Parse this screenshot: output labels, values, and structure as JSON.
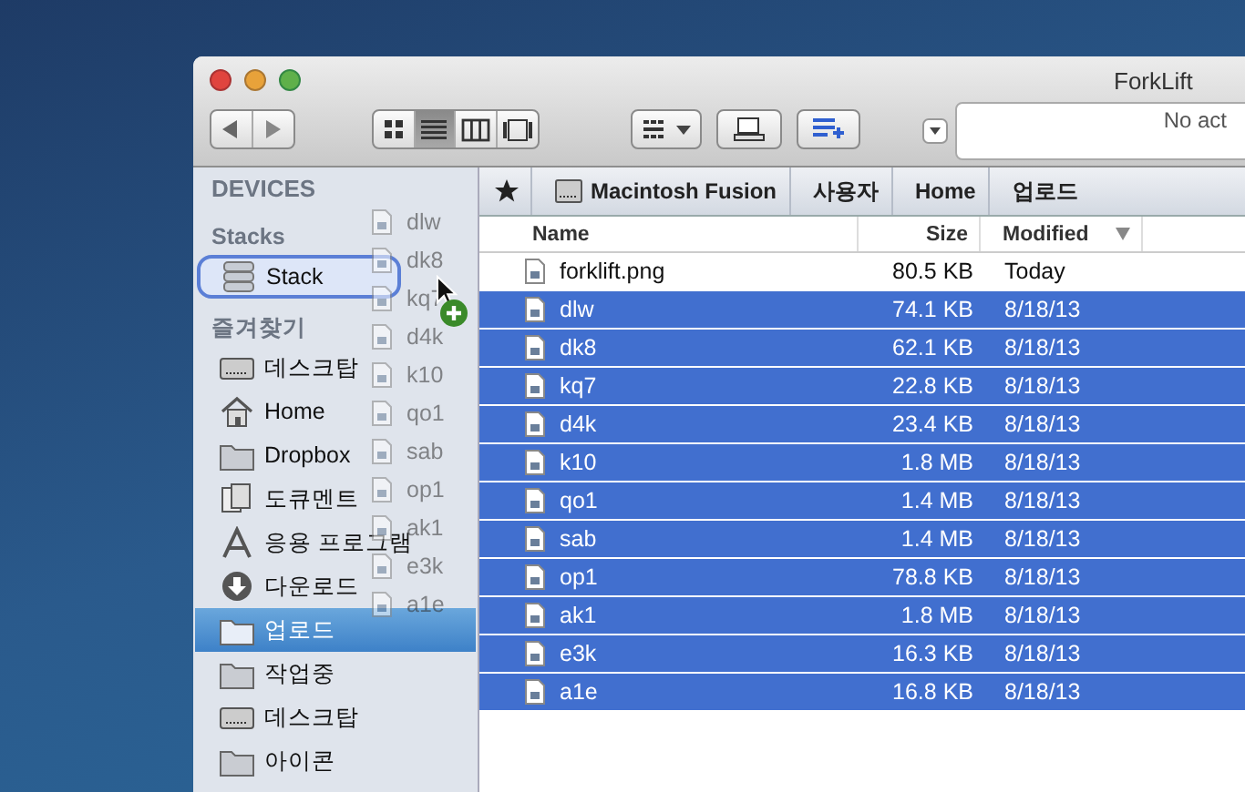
{
  "window": {
    "title": "ForkLift"
  },
  "toolbar": {
    "view_modes": [
      {
        "kind": "icons",
        "selected": false
      },
      {
        "kind": "list",
        "selected": true
      },
      {
        "kind": "columns",
        "selected": false
      },
      {
        "kind": "coverflow",
        "selected": false
      }
    ],
    "search": {
      "placeholder": "No act"
    }
  },
  "sidebar": {
    "sections": [
      {
        "title": "DEVICES"
      },
      {
        "title": "Stacks",
        "items": [
          {
            "label": "Stack",
            "kind": "stack",
            "selected": false,
            "drop_target": true
          }
        ]
      },
      {
        "title": "즐겨찾기",
        "items": [
          {
            "label": "데스크탑",
            "kind": "disk",
            "selected": false,
            "drop_target": false
          },
          {
            "label": "Home",
            "kind": "home",
            "selected": false,
            "drop_target": false
          },
          {
            "label": "Dropbox",
            "kind": "folder",
            "selected": false,
            "drop_target": false
          },
          {
            "label": "도큐멘트",
            "kind": "documents",
            "selected": false,
            "drop_target": false
          },
          {
            "label": "응용 프로그램",
            "kind": "apps",
            "selected": false,
            "drop_target": false
          },
          {
            "label": "다운로드",
            "kind": "download",
            "selected": false,
            "drop_target": false
          },
          {
            "label": "업로드",
            "kind": "folder",
            "selected": true,
            "drop_target": false
          },
          {
            "label": "작업중",
            "kind": "folder",
            "selected": false,
            "drop_target": false
          },
          {
            "label": "데스크탑",
            "kind": "disk",
            "selected": false,
            "drop_target": false
          },
          {
            "label": "아이콘",
            "kind": "folder",
            "selected": false,
            "drop_target": false
          }
        ]
      }
    ]
  },
  "path_bar": [
    {
      "label": "Macintosh Fusion",
      "kind": "disk"
    },
    {
      "label": "사용자",
      "kind": "plain"
    },
    {
      "label": "Home",
      "kind": "plain"
    },
    {
      "label": "업로드",
      "kind": "plain"
    }
  ],
  "table": {
    "columns": [
      {
        "label": "Name",
        "sorted": false
      },
      {
        "label": "Size",
        "sorted": false
      },
      {
        "label": "Modified",
        "sorted": true
      }
    ],
    "rows": [
      {
        "name": "forklift.png",
        "size": "80.5 KB",
        "modified": "Today",
        "selected": false
      },
      {
        "name": "dlw",
        "size": "74.1 KB",
        "modified": "8/18/13",
        "selected": true
      },
      {
        "name": "dk8",
        "size": "62.1 KB",
        "modified": "8/18/13",
        "selected": true
      },
      {
        "name": "kq7",
        "size": "22.8 KB",
        "modified": "8/18/13",
        "selected": true
      },
      {
        "name": "d4k",
        "size": "23.4 KB",
        "modified": "8/18/13",
        "selected": true
      },
      {
        "name": "k10",
        "size": "1.8 MB",
        "modified": "8/18/13",
        "selected": true
      },
      {
        "name": "qo1",
        "size": "1.4 MB",
        "modified": "8/18/13",
        "selected": true
      },
      {
        "name": "sab",
        "size": "1.4 MB",
        "modified": "8/18/13",
        "selected": true
      },
      {
        "name": "op1",
        "size": "78.8 KB",
        "modified": "8/18/13",
        "selected": true
      },
      {
        "name": "ak1",
        "size": "1.8 MB",
        "modified": "8/18/13",
        "selected": true
      },
      {
        "name": "e3k",
        "size": "16.3 KB",
        "modified": "8/18/13",
        "selected": true
      },
      {
        "name": "a1e",
        "size": "16.8 KB",
        "modified": "8/18/13",
        "selected": true
      }
    ]
  },
  "drag": {
    "items": [
      "dlw",
      "dk8",
      "kq7",
      "d4k",
      "k10",
      "qo1",
      "sab",
      "op1",
      "ak1",
      "e3k",
      "a1e"
    ]
  }
}
